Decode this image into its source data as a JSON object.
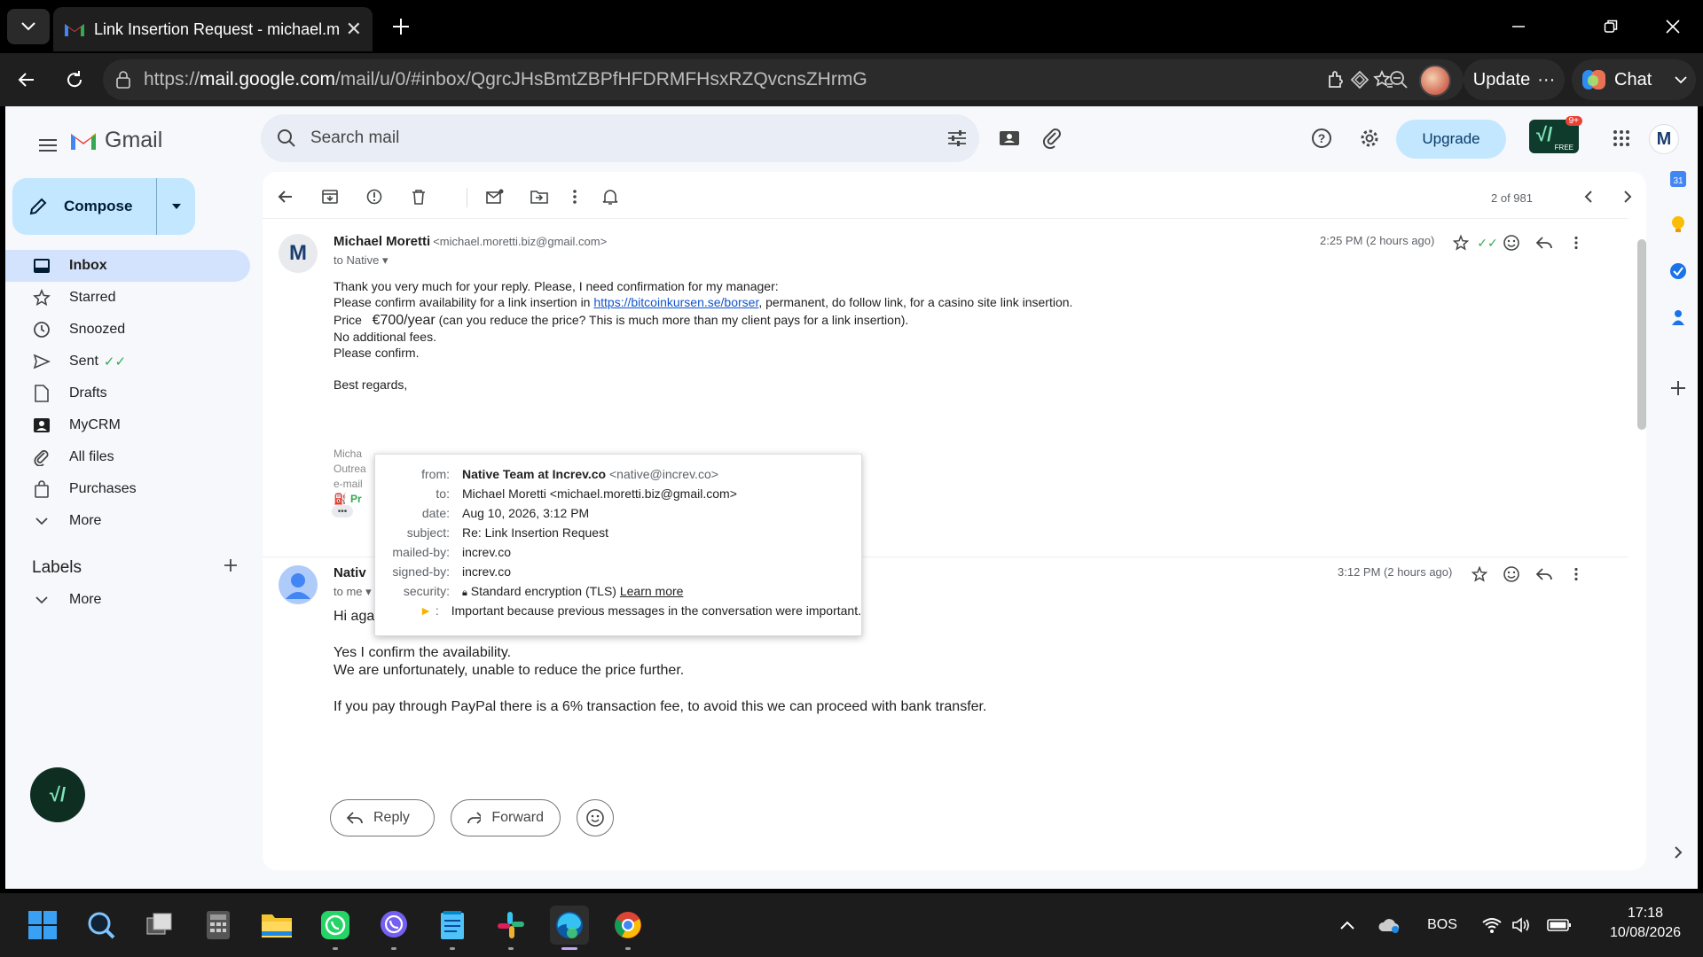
{
  "browser": {
    "tab_title": "Link Insertion Request - michael.m",
    "url_prefix": "https://",
    "url_host": "mail.google.com",
    "url_path": "/mail/u/0/#inbox/QgrcJHsBmtZBPfHFDRMFHsxRZQvcnsZHrmG",
    "update_label": "Update",
    "chat_label": "Chat"
  },
  "gmail": {
    "logo_text": "Gmail",
    "search_placeholder": "Search mail",
    "upgrade_label": "Upgrade",
    "ext_badge": "9+",
    "ext_free": "FREE",
    "avatar_letter": "M",
    "compose_label": "Compose"
  },
  "sidebar": {
    "items": [
      {
        "label": "Inbox",
        "icon": "inbox-icon"
      },
      {
        "label": "Starred",
        "icon": "star-icon"
      },
      {
        "label": "Snoozed",
        "icon": "clock-icon"
      },
      {
        "label": "Sent",
        "icon": "send-icon"
      },
      {
        "label": "Drafts",
        "icon": "draft-icon"
      },
      {
        "label": "MyCRM",
        "icon": "contact-card-icon"
      },
      {
        "label": "All files",
        "icon": "paperclip-icon"
      },
      {
        "label": "Purchases",
        "icon": "bag-icon"
      },
      {
        "label": "More",
        "icon": "chevron-down-icon"
      }
    ],
    "labels_title": "Labels",
    "labels_more": "More"
  },
  "toolbar": {
    "pager": "2 of 981"
  },
  "message1": {
    "avatar_letter": "M",
    "sender_name": "Michael Moretti",
    "sender_email": "<michael.moretti.biz@gmail.com>",
    "to": "to Native",
    "time": "2:25 PM (2 hours ago)",
    "line1": "Thank you very much for your reply. Please, I need confirmation for my manager:",
    "line2_pre": "Please confirm availability for a link insertion in ",
    "line2_link": "https://bitcoinkursen.se/borser",
    "line2_post": ", permanent, do follow link, for a casino site link insertion.",
    "price_label": "Price",
    "price_value": "€700/year",
    "price_note": "(can you reduce the price? This is much more than my client pays for a link insertion).",
    "line4": "No additional fees.",
    "line5": "Please confirm.",
    "regards": "Best regards,",
    "sig1": "Micha",
    "sig2": "Outrea",
    "sig3": "e-mail",
    "sig4": "Pr"
  },
  "popup": {
    "from_label": "from:",
    "from_name": "Native Team at Increv.co",
    "from_email": "<native@increv.co>",
    "to_label": "to:",
    "to_value": "Michael Moretti <michael.moretti.biz@gmail.com>",
    "date_label": "date:",
    "date_value": "Aug 10, 2026, 3:12 PM",
    "subject_label": "subject:",
    "subject_value": "Re: Link Insertion Request",
    "mailedby_label": "mailed-by:",
    "mailedby_value": "increv.co",
    "signedby_label": "signed-by:",
    "signedby_value": "increv.co",
    "security_label": "security:",
    "security_value": "Standard encryption (TLS)",
    "security_link": "Learn more",
    "important_value": "Important because previous messages in the conversation were important."
  },
  "message2": {
    "sender_name": "Nativ",
    "to": "to me",
    "time": "3:12 PM (2 hours ago)",
    "greeting": "Hi again,",
    "line1": "Yes I confirm the availability.",
    "line2": "We are unfortunately, unable to reduce the price further.",
    "line3": "If you pay through PayPal there is a 6% transaction fee, to avoid this we can proceed with bank transfer."
  },
  "replybar": {
    "reply_label": "Reply",
    "forward_label": "Forward"
  },
  "taskbar": {
    "lang": "BOS",
    "time": "17:18",
    "date": "10/08/2026"
  }
}
